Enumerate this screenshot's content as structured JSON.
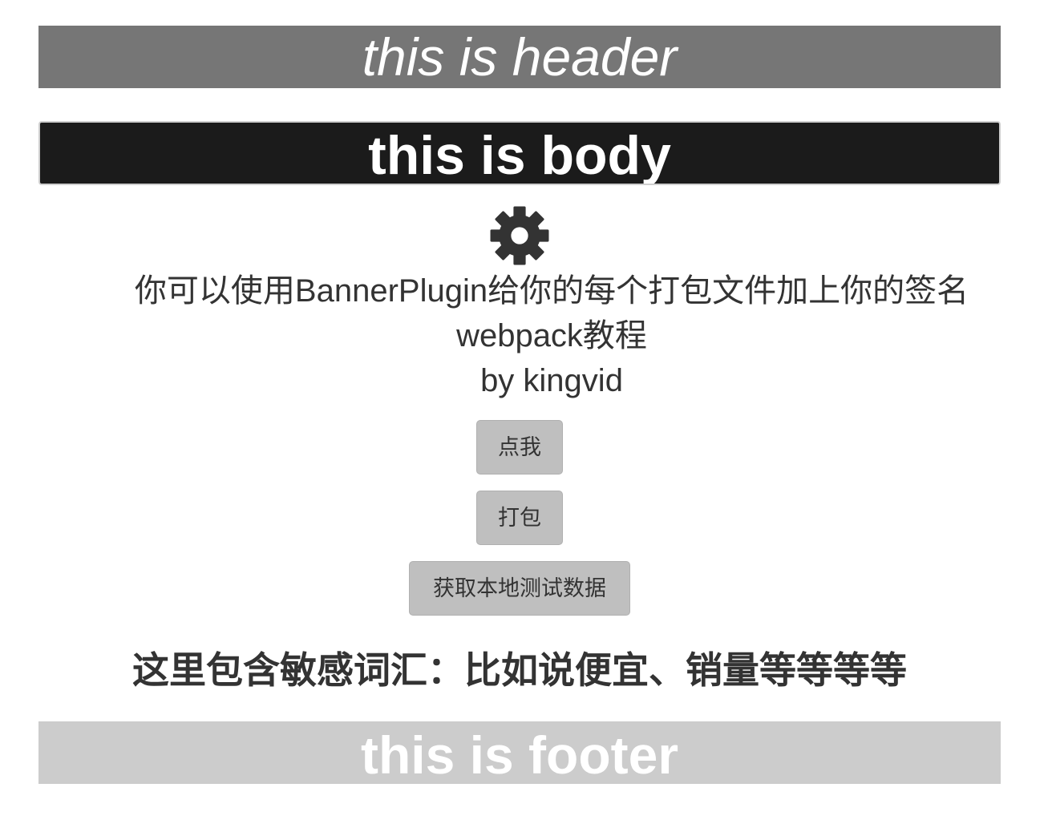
{
  "header": {
    "title": "this is header"
  },
  "body_bar": {
    "title": "this is body"
  },
  "content": {
    "gear_icon": "gear-icon",
    "line1": "你可以使用BannerPlugin给你的每个打包文件加上你的签名",
    "line2": "webpack教程",
    "line3": "by kingvid"
  },
  "buttons": {
    "click_me": "点我",
    "pack": "打包",
    "fetch_local_data": "获取本地测试数据"
  },
  "sensitive_text": "这里包含敏感词汇：比如说便宜、销量等等等等",
  "footer": {
    "title": "this is footer"
  },
  "colors": {
    "header_bg": "#767676",
    "body_bg": "#1b1b1b",
    "footer_bg": "#cccccc",
    "button_bg": "#bfbfbf",
    "text": "#333333"
  }
}
